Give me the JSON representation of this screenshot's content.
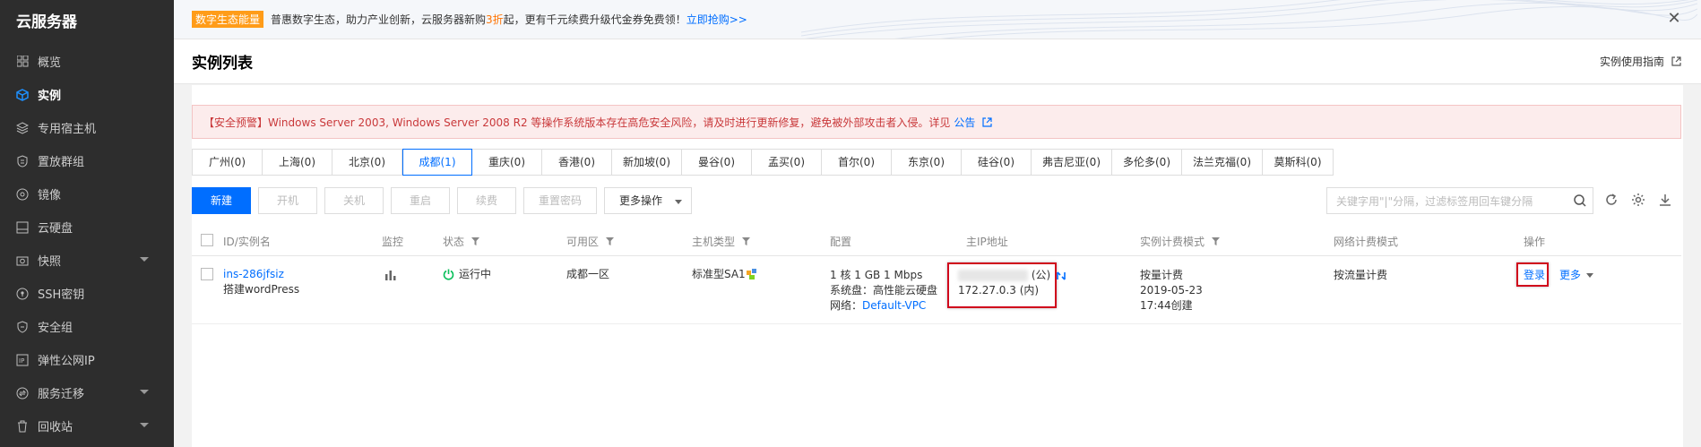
{
  "sidebar": {
    "title": "云服务器",
    "items": [
      {
        "label": "概览",
        "icon": "grid-icon"
      },
      {
        "label": "实例",
        "icon": "cube-icon"
      },
      {
        "label": "专用宿主机",
        "icon": "layers-icon"
      },
      {
        "label": "置放群组",
        "icon": "group-icon"
      },
      {
        "label": "镜像",
        "icon": "disc-icon"
      },
      {
        "label": "云硬盘",
        "icon": "disk-icon"
      },
      {
        "label": "快照",
        "icon": "camera-icon"
      },
      {
        "label": "SSH密钥",
        "icon": "key-icon"
      },
      {
        "label": "安全组",
        "icon": "shield-icon"
      },
      {
        "label": "弹性公网IP",
        "icon": "ip-icon"
      },
      {
        "label": "服务迁移",
        "icon": "migrate-icon"
      },
      {
        "label": "回收站",
        "icon": "trash-icon"
      }
    ]
  },
  "banner": {
    "tag": "数字生态能量",
    "text_before": "普惠数字生态，助力产业创新，云服务器新购",
    "highlight": "3折",
    "text_after": "起，更有千元续费升级代金券免费领！",
    "link": "立即抢购>>"
  },
  "header": {
    "title": "实例列表",
    "guide_link": "实例使用指南"
  },
  "alert": {
    "text": "【安全预警】Windows Server 2003, Windows Server 2008 R2 等操作系统版本存在高危安全风险，请及时进行更新修复，避免被外部攻击者入侵。详见",
    "link": "公告"
  },
  "regions": [
    "广州(0)",
    "上海(0)",
    "北京(0)",
    "成都(1)",
    "重庆(0)",
    "香港(0)",
    "新加坡(0)",
    "曼谷(0)",
    "孟买(0)",
    "首尔(0)",
    "东京(0)",
    "硅谷(0)",
    "弗吉尼亚(0)",
    "多伦多(0)",
    "法兰克福(0)",
    "莫斯科(0)"
  ],
  "toolbar": {
    "new": "新建",
    "start": "开机",
    "stop": "关机",
    "restart": "重启",
    "renew": "续费",
    "reset_pwd": "重置密码",
    "more_ops": "更多操作",
    "search_placeholder": "关键字用\"|\"分隔，过滤标签用回车键分隔"
  },
  "table": {
    "headers": {
      "id": "ID/实例名",
      "monitor": "监控",
      "status": "状态",
      "zone": "可用区",
      "type": "主机类型",
      "config": "配置",
      "ip": "主IP地址",
      "billing": "实例计费模式",
      "net_billing": "网络计费模式",
      "ops": "操作"
    },
    "rows": [
      {
        "id": "ins-286jfsiz",
        "name": "搭建wordPress",
        "status": "运行中",
        "zone": "成都一区",
        "type": "标准型SA1",
        "config_line1": "1 核 1 GB 1 Mbps",
        "config_line2": "系统盘：高性能云硬盘",
        "config_net_label": "网络：",
        "config_net_link": "Default-VPC",
        "ip_public_suffix": "(公)",
        "ip_private": "172.27.0.3 (内)",
        "billing_line1": "按量计费",
        "billing_line2": "2019-05-23",
        "billing_line3": "17:44创建",
        "net_billing": "按流量计费",
        "op_login": "登录",
        "op_more": "更多"
      }
    ]
  },
  "colors": {
    "accent": "#006eff",
    "sidebar_bg": "#2d2d2d",
    "alert_text": "#c9383a",
    "status_ok": "#0abf5b",
    "highlight_box": "#d0021b"
  }
}
